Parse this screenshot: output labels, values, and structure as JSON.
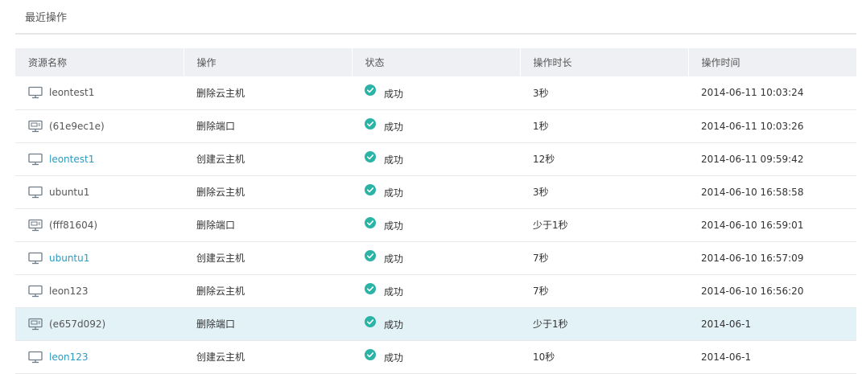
{
  "section_title": "最近操作",
  "columns": [
    "资源名称",
    "操作",
    "状态",
    "操作时长",
    "操作时间"
  ],
  "rows": [
    {
      "icon": "monitor-icon",
      "name": "leontest1",
      "link": false,
      "action": "删除云主机",
      "status": "成功",
      "duration": "3秒",
      "time": "2014-06-11 10:03:24"
    },
    {
      "icon": "network-port-icon",
      "name": "(61e9ec1e)",
      "link": false,
      "action": "删除端口",
      "status": "成功",
      "duration": "1秒",
      "time": "2014-06-11 10:03:26"
    },
    {
      "icon": "monitor-icon",
      "name": "leontest1",
      "link": true,
      "action": "创建云主机",
      "status": "成功",
      "duration": "12秒",
      "time": "2014-06-11 09:59:42"
    },
    {
      "icon": "monitor-icon",
      "name": "ubuntu1",
      "link": false,
      "action": "删除云主机",
      "status": "成功",
      "duration": "3秒",
      "time": "2014-06-10 16:58:58"
    },
    {
      "icon": "network-port-icon",
      "name": "(fff81604)",
      "link": false,
      "action": "删除端口",
      "status": "成功",
      "duration": "少于1秒",
      "time": "2014-06-10 16:59:01"
    },
    {
      "icon": "monitor-icon",
      "name": "ubuntu1",
      "link": true,
      "action": "创建云主机",
      "status": "成功",
      "duration": "7秒",
      "time": "2014-06-10 16:57:09"
    },
    {
      "icon": "monitor-icon",
      "name": "leon123",
      "link": false,
      "action": "删除云主机",
      "status": "成功",
      "duration": "7秒",
      "time": "2014-06-10 16:56:20"
    },
    {
      "icon": "network-port-icon",
      "name": "(e657d092)",
      "link": false,
      "action": "删除端口",
      "status": "成功",
      "duration": "少于1秒",
      "time": "2014-06-1"
    },
    {
      "icon": "monitor-icon",
      "name": "leon123",
      "link": true,
      "action": "创建云主机",
      "status": "成功",
      "duration": "10秒",
      "time": "2014-06-1"
    }
  ],
  "colors": {
    "link": "#2a9bc0",
    "success": "#2bb3a6",
    "header_bg": "#eef0f3",
    "selected_row_bg": "#e3f2f7"
  }
}
